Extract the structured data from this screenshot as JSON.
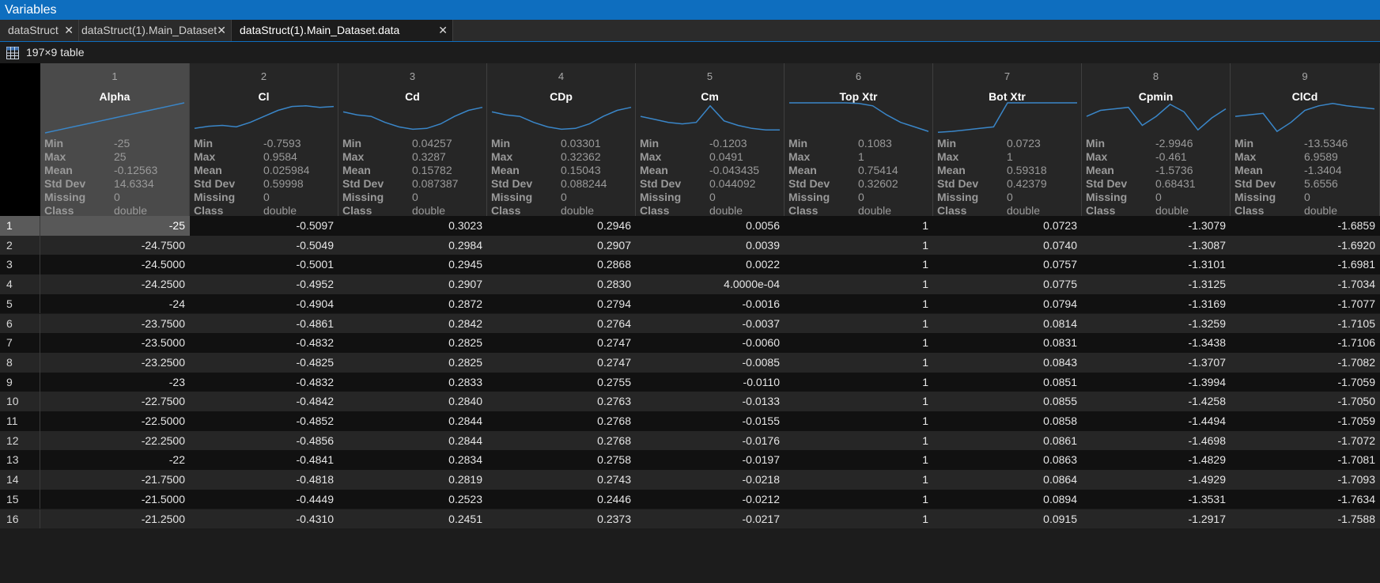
{
  "window": {
    "title": "Variables"
  },
  "tabs": [
    {
      "label": "dataStruct",
      "active": false
    },
    {
      "label": "dataStruct(1).Main_Dataset",
      "active": false
    },
    {
      "label": "dataStruct(1).Main_Dataset.data",
      "active": true
    }
  ],
  "tab_close_glyph": "✕",
  "size_label": "197×9 table",
  "stat_labels": [
    "Min",
    "Max",
    "Mean",
    "Std Dev",
    "Missing",
    "Class"
  ],
  "columns": [
    {
      "index": "1",
      "name": "Alpha",
      "stats": [
        "-25",
        "25",
        "-0.12563",
        "14.6334",
        "0",
        "double"
      ],
      "sparkline": [
        0.0,
        0.1,
        0.2,
        0.3,
        0.4,
        0.5,
        0.6,
        0.7,
        0.8,
        0.9,
        1.0
      ]
    },
    {
      "index": "2",
      "name": "Cl",
      "stats": [
        "-0.7593",
        "0.9584",
        "0.025984",
        "0.59998",
        "0",
        "double"
      ],
      "sparkline": [
        0.15,
        0.22,
        0.25,
        0.2,
        0.35,
        0.55,
        0.75,
        0.88,
        0.9,
        0.85,
        0.88
      ]
    },
    {
      "index": "3",
      "name": "Cd",
      "stats": [
        "0.04257",
        "0.3287",
        "0.15782",
        "0.087387",
        "0",
        "double"
      ],
      "sparkline": [
        0.7,
        0.6,
        0.55,
        0.35,
        0.2,
        0.12,
        0.15,
        0.3,
        0.55,
        0.75,
        0.85
      ]
    },
    {
      "index": "4",
      "name": "CDp",
      "stats": [
        "0.03301",
        "0.32362",
        "0.15043",
        "0.088244",
        "0",
        "double"
      ],
      "sparkline": [
        0.7,
        0.6,
        0.55,
        0.35,
        0.2,
        0.12,
        0.15,
        0.3,
        0.55,
        0.75,
        0.85
      ]
    },
    {
      "index": "5",
      "name": "Cm",
      "stats": [
        "-0.1203",
        "0.0491",
        "-0.043435",
        "0.044092",
        "0",
        "double"
      ],
      "sparkline": [
        0.55,
        0.45,
        0.35,
        0.3,
        0.35,
        0.9,
        0.4,
        0.25,
        0.15,
        0.1,
        0.1
      ]
    },
    {
      "index": "6",
      "name": "Top Xtr",
      "stats": [
        "0.1083",
        "1",
        "0.75414",
        "0.32602",
        "0",
        "double"
      ],
      "sparkline": [
        1.0,
        1.0,
        1.0,
        1.0,
        1.0,
        0.98,
        0.9,
        0.6,
        0.35,
        0.2,
        0.05
      ]
    },
    {
      "index": "7",
      "name": "Bot Xtr",
      "stats": [
        "0.0723",
        "1",
        "0.59318",
        "0.42379",
        "0",
        "double"
      ],
      "sparkline": [
        0.02,
        0.05,
        0.1,
        0.15,
        0.2,
        1.0,
        1.0,
        1.0,
        1.0,
        1.0,
        1.0
      ]
    },
    {
      "index": "8",
      "name": "Cpmin",
      "stats": [
        "-2.9946",
        "-0.461",
        "-1.5736",
        "0.68431",
        "0",
        "double"
      ],
      "sparkline": [
        0.55,
        0.75,
        0.8,
        0.85,
        0.25,
        0.55,
        0.95,
        0.7,
        0.1,
        0.5,
        0.8
      ]
    },
    {
      "index": "9",
      "name": "ClCd",
      "stats": [
        "-13.5346",
        "6.9589",
        "-1.3404",
        "5.6556",
        "0",
        "double"
      ],
      "sparkline": [
        0.55,
        0.6,
        0.65,
        0.05,
        0.35,
        0.75,
        0.9,
        0.98,
        0.9,
        0.85,
        0.8
      ]
    }
  ],
  "rows": [
    {
      "num": "1",
      "cells": [
        "-25",
        "-0.5097",
        "0.3023",
        "0.2946",
        "0.0056",
        "1",
        "0.0723",
        "-1.3079",
        "-1.6859"
      ]
    },
    {
      "num": "2",
      "cells": [
        "-24.7500",
        "-0.5049",
        "0.2984",
        "0.2907",
        "0.0039",
        "1",
        "0.0740",
        "-1.3087",
        "-1.6920"
      ]
    },
    {
      "num": "3",
      "cells": [
        "-24.5000",
        "-0.5001",
        "0.2945",
        "0.2868",
        "0.0022",
        "1",
        "0.0757",
        "-1.3101",
        "-1.6981"
      ]
    },
    {
      "num": "4",
      "cells": [
        "-24.2500",
        "-0.4952",
        "0.2907",
        "0.2830",
        "4.0000e-04",
        "1",
        "0.0775",
        "-1.3125",
        "-1.7034"
      ]
    },
    {
      "num": "5",
      "cells": [
        "-24",
        "-0.4904",
        "0.2872",
        "0.2794",
        "-0.0016",
        "1",
        "0.0794",
        "-1.3169",
        "-1.7077"
      ]
    },
    {
      "num": "6",
      "cells": [
        "-23.7500",
        "-0.4861",
        "0.2842",
        "0.2764",
        "-0.0037",
        "1",
        "0.0814",
        "-1.3259",
        "-1.7105"
      ]
    },
    {
      "num": "7",
      "cells": [
        "-23.5000",
        "-0.4832",
        "0.2825",
        "0.2747",
        "-0.0060",
        "1",
        "0.0831",
        "-1.3438",
        "-1.7106"
      ]
    },
    {
      "num": "8",
      "cells": [
        "-23.2500",
        "-0.4825",
        "0.2825",
        "0.2747",
        "-0.0085",
        "1",
        "0.0843",
        "-1.3707",
        "-1.7082"
      ]
    },
    {
      "num": "9",
      "cells": [
        "-23",
        "-0.4832",
        "0.2833",
        "0.2755",
        "-0.0110",
        "1",
        "0.0851",
        "-1.3994",
        "-1.7059"
      ]
    },
    {
      "num": "10",
      "cells": [
        "-22.7500",
        "-0.4842",
        "0.2840",
        "0.2763",
        "-0.0133",
        "1",
        "0.0855",
        "-1.4258",
        "-1.7050"
      ]
    },
    {
      "num": "11",
      "cells": [
        "-22.5000",
        "-0.4852",
        "0.2844",
        "0.2768",
        "-0.0155",
        "1",
        "0.0858",
        "-1.4494",
        "-1.7059"
      ]
    },
    {
      "num": "12",
      "cells": [
        "-22.2500",
        "-0.4856",
        "0.2844",
        "0.2768",
        "-0.0176",
        "1",
        "0.0861",
        "-1.4698",
        "-1.7072"
      ]
    },
    {
      "num": "13",
      "cells": [
        "-22",
        "-0.4841",
        "0.2834",
        "0.2758",
        "-0.0197",
        "1",
        "0.0863",
        "-1.4829",
        "-1.7081"
      ]
    },
    {
      "num": "14",
      "cells": [
        "-21.7500",
        "-0.4818",
        "0.2819",
        "0.2743",
        "-0.0218",
        "1",
        "0.0864",
        "-1.4929",
        "-1.7093"
      ]
    },
    {
      "num": "15",
      "cells": [
        "-21.5000",
        "-0.4449",
        "0.2523",
        "0.2446",
        "-0.0212",
        "1",
        "0.0894",
        "-1.3531",
        "-1.7634"
      ]
    },
    {
      "num": "16",
      "cells": [
        "-21.2500",
        "-0.4310",
        "0.2451",
        "0.2373",
        "-0.0217",
        "1",
        "0.0915",
        "-1.2917",
        "-1.7588"
      ]
    }
  ],
  "colors": {
    "accent": "#0e6ebf",
    "sparkline": "#3a86c8"
  }
}
